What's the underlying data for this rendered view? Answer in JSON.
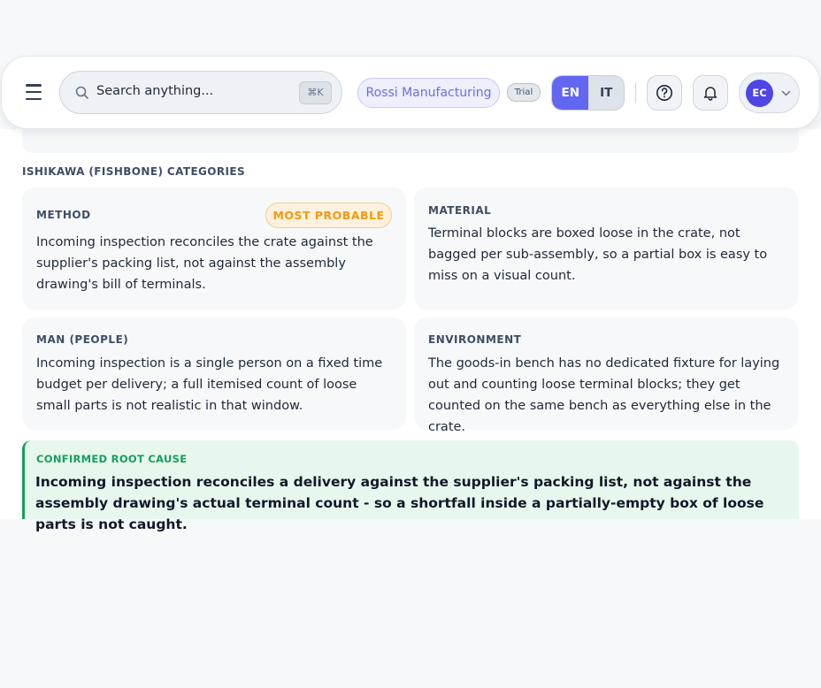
{
  "header": {
    "search_placeholder": "Search anything...",
    "search_shortcut": "⌘K",
    "organization": "Rossi Manufacturing",
    "plan_badge": "Trial",
    "languages": [
      "EN",
      "IT"
    ],
    "active_language": "EN",
    "user_initials": "EC",
    "icons": [
      "menu-icon",
      "search-icon",
      "help-icon",
      "bell-icon",
      "chevron-down-icon"
    ]
  },
  "ishikawa": {
    "section_title": "ISHIKAWA (FISHBONE) CATEGORIES",
    "categories": [
      {
        "title": "METHOD",
        "badge": "MOST PROBABLE",
        "text": "Incoming inspection reconciles the crate against the supplier's packing list, not against the assembly drawing's bill of terminals."
      },
      {
        "title": "MATERIAL",
        "text": "Terminal blocks are boxed loose in the crate, not bagged per sub-assembly, so a partial box is easy to miss on a visual count."
      },
      {
        "title": "MAN (PEOPLE)",
        "text": "Incoming inspection is a single person on a fixed time budget per delivery; a full itemised count of loose small parts is not realistic in that window."
      },
      {
        "title": "ENVIRONMENT",
        "text": "The goods-in bench has no dedicated fixture for laying out and counting loose terminal blocks; they get counted on the same bench as everything else in the crate."
      }
    ]
  },
  "root_cause": {
    "label": "CONFIRMED ROOT CAUSE",
    "text": "Incoming inspection reconciles a delivery against the supplier's packing list, not against the assembly drawing's actual terminal count - so a shortfall inside a partially-empty box of loose parts is not caught."
  },
  "colors": {
    "accent": "#6366f1",
    "badge_text": "#f29a12",
    "root_cause_green": "#13a05a"
  }
}
